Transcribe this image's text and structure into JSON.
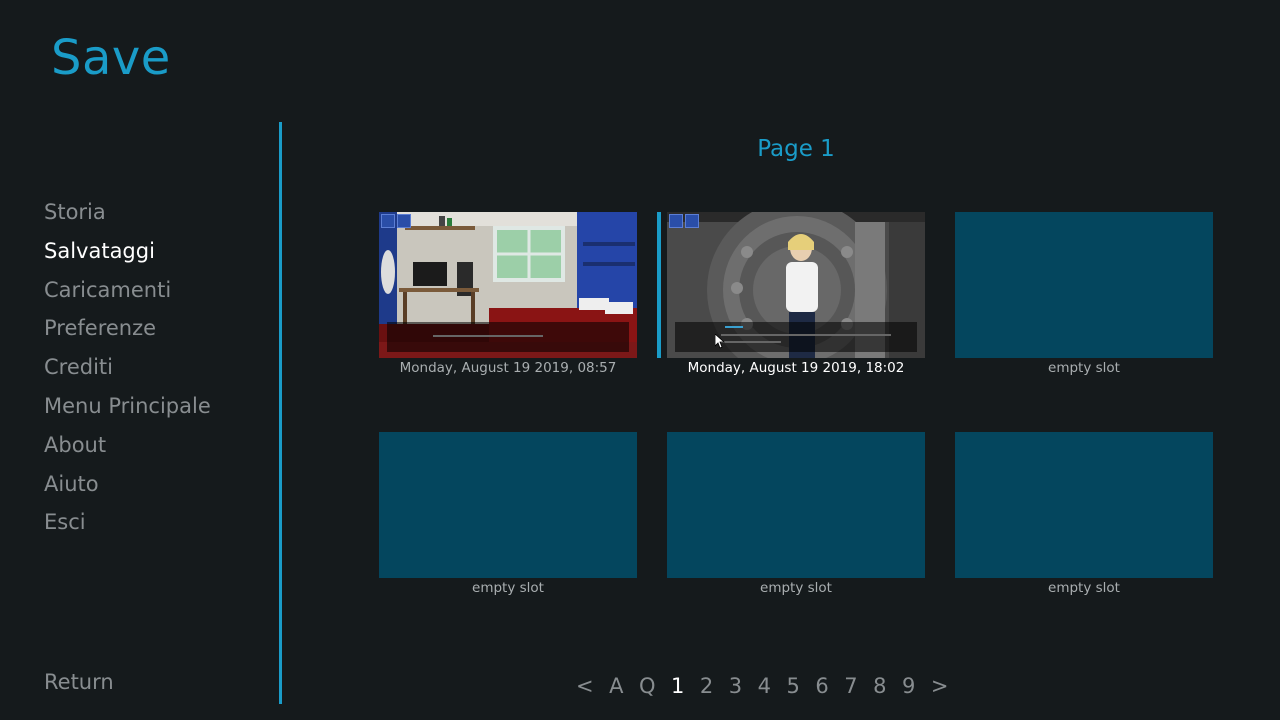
{
  "screen": {
    "title": "Save"
  },
  "nav": {
    "items": [
      {
        "label": "Storia",
        "active": false
      },
      {
        "label": "Salvataggi",
        "active": true
      },
      {
        "label": "Caricamenti",
        "active": false
      },
      {
        "label": "Preferenze",
        "active": false
      },
      {
        "label": "Crediti",
        "active": false
      },
      {
        "label": "Menu Principale",
        "active": false
      },
      {
        "label": "About",
        "active": false
      },
      {
        "label": "Aiuto",
        "active": false
      },
      {
        "label": "Esci",
        "active": false
      }
    ],
    "return_label": "Return"
  },
  "page": {
    "title": "Page 1"
  },
  "slots": [
    {
      "label": "Monday, August 19 2019, 08:57",
      "thumbnail": "bedroom-screenshot",
      "selected": false
    },
    {
      "label": "Monday, August 19 2019, 18:02",
      "thumbnail": "vault-character-screenshot",
      "selected": true
    },
    {
      "label": "empty slot",
      "thumbnail": null,
      "selected": false
    },
    {
      "label": "empty slot",
      "thumbnail": null,
      "selected": false
    },
    {
      "label": "empty slot",
      "thumbnail": null,
      "selected": false
    },
    {
      "label": "empty slot",
      "thumbnail": null,
      "selected": false
    }
  ],
  "pager": {
    "items": [
      "<",
      "A",
      "Q",
      "1",
      "2",
      "3",
      "4",
      "5",
      "6",
      "7",
      "8",
      "9",
      ">"
    ],
    "current": "1"
  },
  "colors": {
    "accent": "#1a9cc8",
    "background": "#151a1c",
    "empty_slot": "#04465e",
    "inactive_text": "#888d90",
    "active_text": "#ffffff"
  }
}
